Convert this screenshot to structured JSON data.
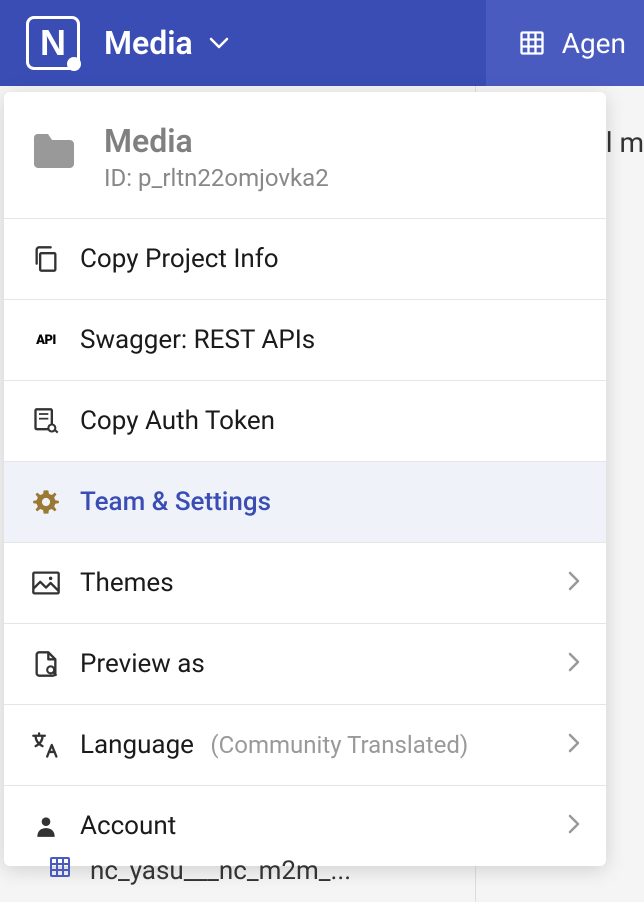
{
  "header": {
    "title": "Media",
    "rightTabLabel": "Agen"
  },
  "project": {
    "name": "Media",
    "idLabel": "ID: p_rltn22omjovka2"
  },
  "menu": {
    "copyProjectInfo": "Copy Project Info",
    "swagger": "Swagger: REST APIs",
    "copyAuthToken": "Copy Auth Token",
    "teamSettings": "Team & Settings",
    "themes": "Themes",
    "previewAs": "Preview as",
    "language": "Language",
    "languageSub": "(Community Translated)",
    "account": "Account"
  },
  "background": {
    "rightText": "l m",
    "bottomItem": "nc_yasu___nc_m2m_..."
  }
}
